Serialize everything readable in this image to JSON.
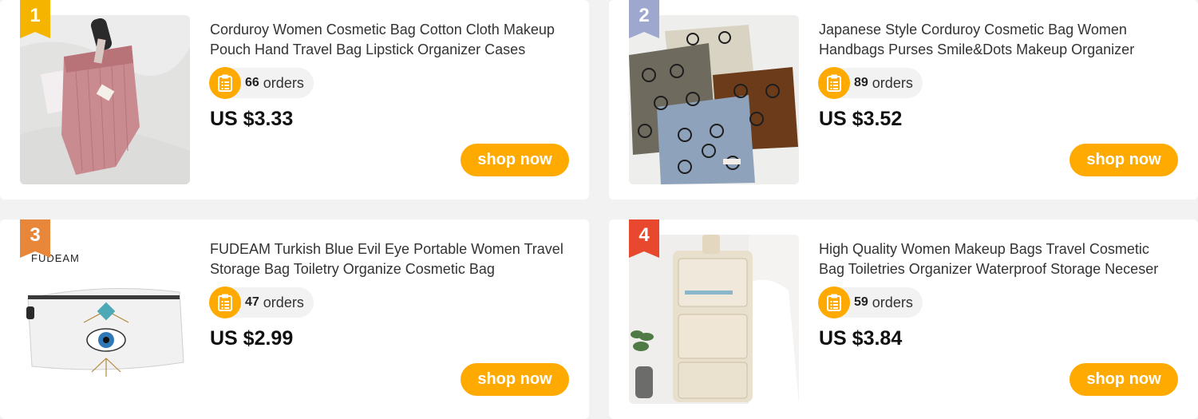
{
  "products": [
    {
      "rank": "1",
      "title": "Corduroy Women Cosmetic Bag Cotton Cloth Makeup Pouch Hand Travel Bag Lipstick Organizer Cases",
      "orders_count": "66",
      "orders_label": "orders",
      "price": "US $3.33",
      "button": "shop now",
      "badge_color": "#f5b400"
    },
    {
      "rank": "2",
      "title": "Japanese Style Corduroy Cosmetic Bag Women Handbags Purses Smile&Dots Makeup Organizer",
      "orders_count": "89",
      "orders_label": "orders",
      "price": "US $3.52",
      "button": "shop now",
      "badge_color": "#9ea8cf"
    },
    {
      "rank": "3",
      "title": "FUDEAM Turkish Blue Evil Eye Portable Women Travel Storage Bag Toiletry Organize Cosmetic Bag",
      "orders_count": "47",
      "orders_label": "orders",
      "price": "US $2.99",
      "button": "shop now",
      "badge_color": "#e8873a",
      "image_brand_text": "FUDEAM"
    },
    {
      "rank": "4",
      "title": "High Quality Women Makeup Bags Travel Cosmetic Bag Toiletries Organizer Waterproof Storage Neceser",
      "orders_count": "59",
      "orders_label": "orders",
      "price": "US $3.84",
      "button": "shop now",
      "badge_color": "#e8492e"
    }
  ],
  "accent_color": "#ffaa00",
  "icons": {
    "orders": "clipboard-list-icon"
  }
}
